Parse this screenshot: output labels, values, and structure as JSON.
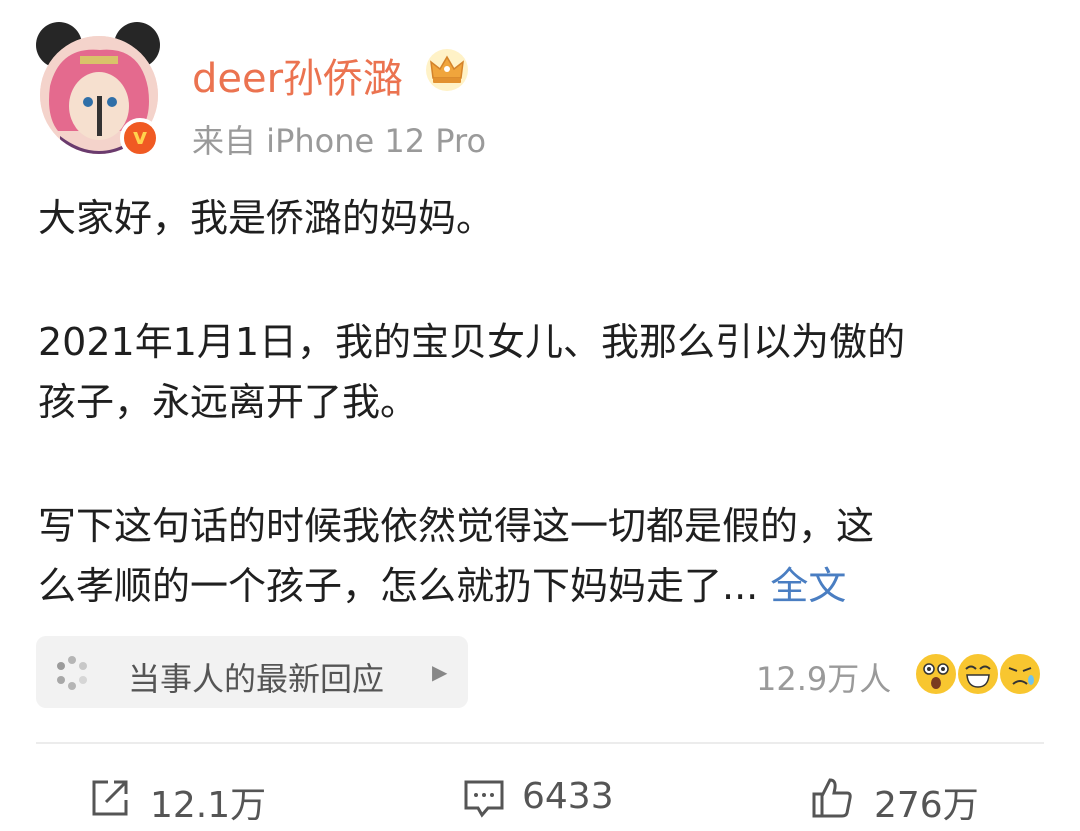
{
  "header": {
    "username": "deer孙侨潞",
    "source": "来自 iPhone 12 Pro",
    "avatar_icon": "avatar-icon",
    "verified_icon": "verified-badge-icon",
    "verified_mark": "v",
    "crown_icon": "crown-icon"
  },
  "post": {
    "para1_line1": "大家好，我是侨潞的妈妈。",
    "para2_line1": "2021年1月1日，我的宝贝女儿、我那么引以为傲的",
    "para2_line2": "孩子，永远离开了我。",
    "para3_line1": "写下这句话的时候我依然觉得这一切都是假的，这",
    "para3_line2": "么孝顺的一个孩子，怎么就扔下妈妈走了... ",
    "more_link": "全文"
  },
  "reactions": {
    "reply_label": "当事人的最新回应",
    "reply_arrow": "▶",
    "reach": "12.9万人",
    "emoji_icons": [
      "shocked-emoji-icon",
      "laughing-emoji-icon",
      "crying-emoji-icon"
    ]
  },
  "actions": {
    "repost": "12.1万",
    "comment": "6433",
    "like": "276万"
  },
  "colors": {
    "username": "#eb7350",
    "link": "#4a7ec2",
    "muted": "#9a9a9a"
  }
}
